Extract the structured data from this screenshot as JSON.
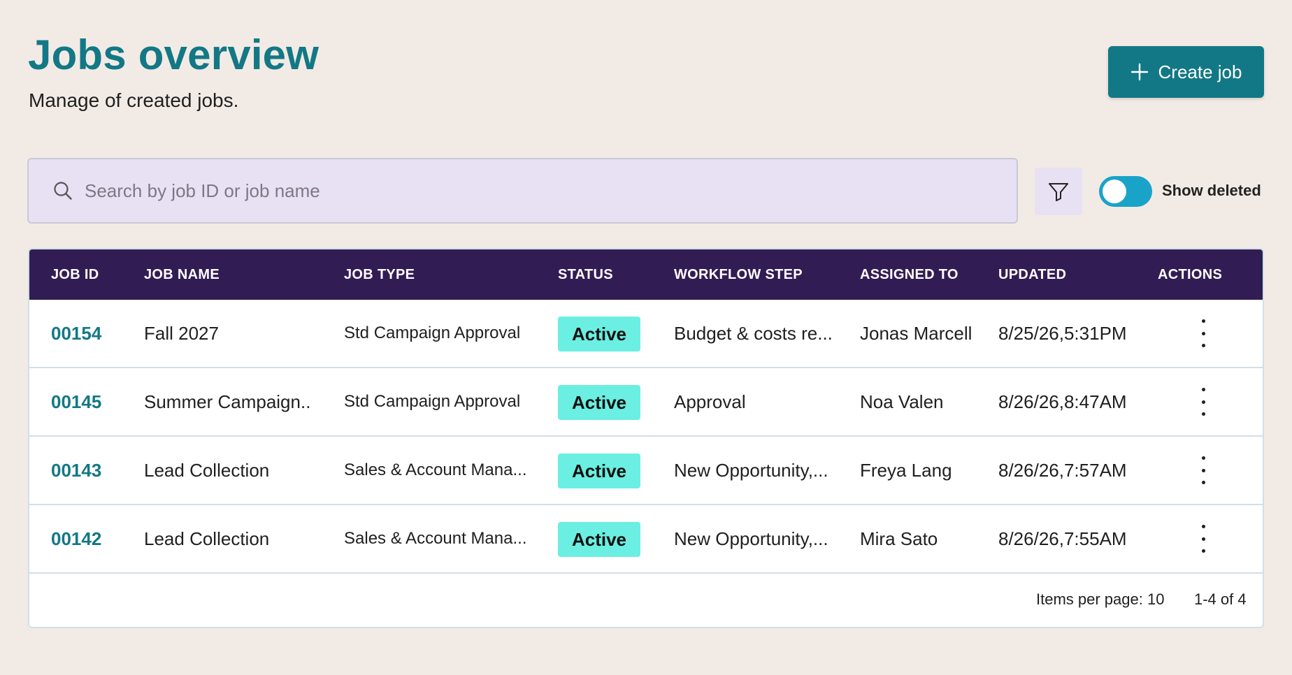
{
  "header": {
    "title": "Jobs overview",
    "subtitle": "Manage of created jobs.",
    "create_button": "Create job"
  },
  "search": {
    "placeholder": "Search by job ID or job name"
  },
  "filters": {
    "filter_icon": "filter-icon",
    "show_deleted_label": "Show deleted",
    "show_deleted_on": true
  },
  "table": {
    "columns": [
      "JOB ID",
      "JOB NAME",
      "JOB TYPE",
      "STATUS",
      "WORKFLOW STEP",
      "ASSIGNED TO",
      "UPDATED",
      "ACTIONS"
    ],
    "rows": [
      {
        "id": "00154",
        "name": "Fall 2027",
        "type": "Std Campaign Approval",
        "status": "Active",
        "step": "Budget & costs re...",
        "assignee": "Jonas Marcell",
        "updated": "8/25/26,5:31PM"
      },
      {
        "id": "00145",
        "name": "Summer Campaign..",
        "type": "Std Campaign Approval",
        "status": "Active",
        "step": "Approval",
        "assignee": "Noa Valen",
        "updated": "8/26/26,8:47AM"
      },
      {
        "id": "00143",
        "name": "Lead Collection",
        "type": "Sales & Account Mana...",
        "status": "Active",
        "step": "New Opportunity,...",
        "assignee": "Freya Lang",
        "updated": "8/26/26,7:57AM"
      },
      {
        "id": "00142",
        "name": "Lead Collection",
        "type": "Sales & Account Mana...",
        "status": "Active",
        "step": "New Opportunity,...",
        "assignee": "Mira Sato",
        "updated": "8/26/26,7:55AM"
      }
    ],
    "footer": {
      "items_per_page": "Items per page: 10",
      "range": "1-4 of 4"
    }
  },
  "colors": {
    "accent": "#137885",
    "header_bg": "#321c54",
    "status_active": "#6aefe2",
    "toggle": "#1aa3c8",
    "page_bg": "#f2ebe5",
    "search_bg": "#e8e0f3"
  }
}
